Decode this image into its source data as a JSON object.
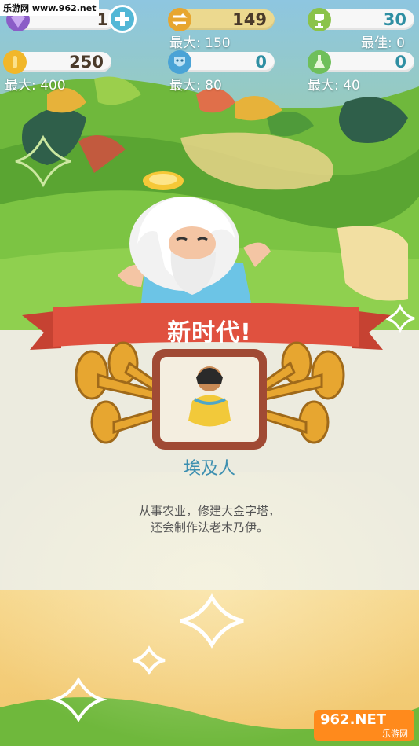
{
  "hud": {
    "gems": {
      "value": "1",
      "icon": "gem-icon"
    },
    "add": {
      "icon": "plus-icon"
    },
    "progress": {
      "value": "149",
      "max_label": "最大: 150",
      "icon": "progress-arrows-icon"
    },
    "trophy": {
      "value": "30",
      "max_label": "最佳: 0",
      "icon": "trophy-icon"
    },
    "coins": {
      "value": "250",
      "max_label": "最大: 400",
      "icon": "coin-icon"
    },
    "culture": {
      "value": "0",
      "max_label": "最大: 80",
      "icon": "theater-mask-icon"
    },
    "science": {
      "value": "0",
      "max_label": "最大: 40",
      "icon": "flask-icon"
    }
  },
  "dialog": {
    "title": "新时代!",
    "era_name": "埃及人",
    "description_lines": [
      "从事农业，修建大金字塔，",
      "还会制作法老木乃伊。"
    ]
  },
  "watermark": {
    "top_text": "乐游网 www.962.net",
    "logo_text": "962.NET",
    "logo_sub": "乐游网"
  },
  "colors": {
    "ribbon": "#e0513f",
    "frame": "#a04a34",
    "horn": "#e7a630",
    "panel": "#ecebdf",
    "teal_text": "#2f8fa3"
  }
}
